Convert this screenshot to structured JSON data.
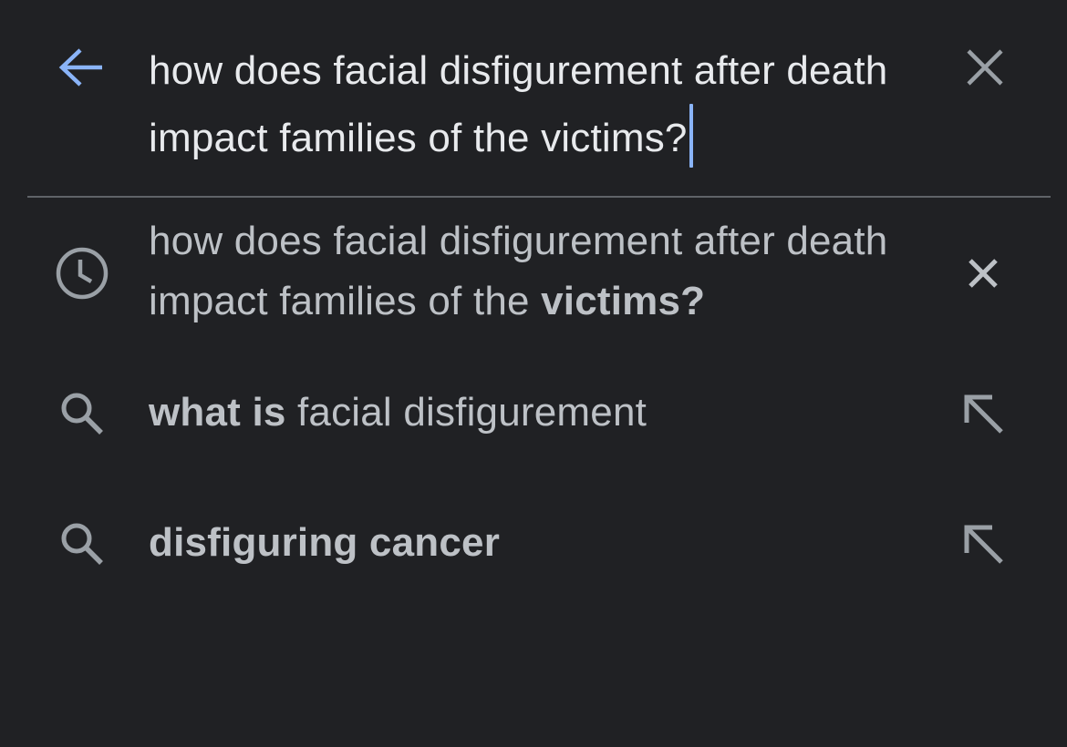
{
  "search": {
    "query": "how does facial disfigurement after death impact families of the victims?",
    "back_icon": "arrow-back-icon",
    "clear_icon": "close-icon",
    "accent_color": "#8ab4f8"
  },
  "suggestions": [
    {
      "type": "history",
      "icon": "history-clock-icon",
      "prefix": "how does facial disfigurement after death impact families of the ",
      "bold": "victims?",
      "action_icon": "remove-icon"
    },
    {
      "type": "search",
      "icon": "search-icon",
      "bold": "what is",
      "suffix": " facial disfigurement",
      "action_icon": "fill-query-arrow-icon"
    },
    {
      "type": "search",
      "icon": "search-icon",
      "bold": "disfiguring cancer",
      "action_icon": "fill-query-arrow-icon"
    }
  ],
  "colors": {
    "background": "#202124",
    "text_primary": "#e8eaed",
    "text_secondary": "#bdc1c6",
    "icon_gray": "#9aa0a6",
    "divider": "#5f6368"
  }
}
